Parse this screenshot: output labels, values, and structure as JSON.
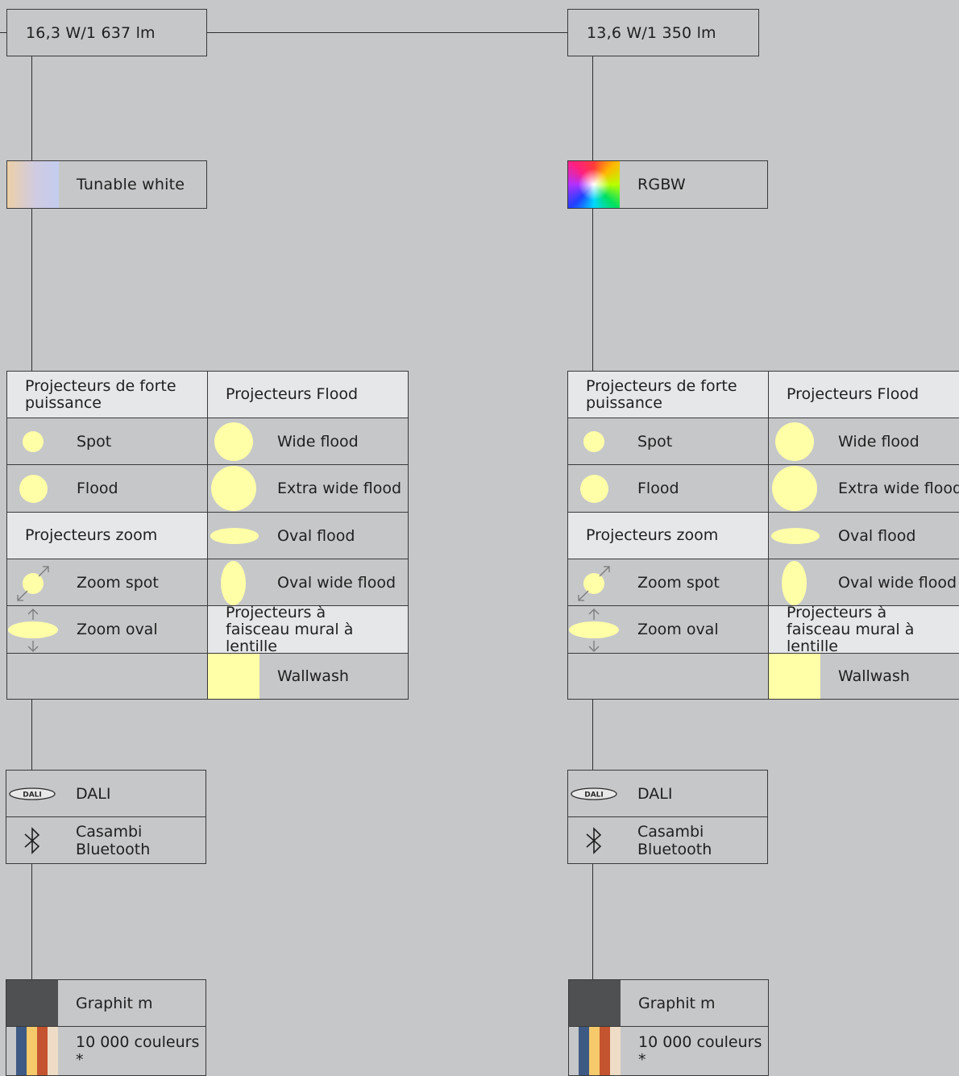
{
  "columns": [
    {
      "power": "16,3 W/1 637 lm",
      "color_mode": "Tunable white",
      "optics": {
        "high_power_header": "Projecteurs de forte puissance",
        "flood_header": "Projecteurs Flood",
        "zoom_header": "Projecteurs zoom",
        "wallwash_header": "Projecteurs à faisceau mural à lentille",
        "spot": "Spot",
        "flood": "Flood",
        "zoom_spot": "Zoom spot",
        "zoom_oval": "Zoom oval",
        "wide_flood": "Wide flood",
        "extra_wide_flood": "Extra wide flood",
        "oval_flood": "Oval flood",
        "oval_wide_flood": "Oval wide flood",
        "wallwash": "Wallwash"
      },
      "control": {
        "dali": "DALI",
        "dali_logo": "DALI",
        "bluetooth": "Casambi Bluetooth"
      },
      "finish": {
        "graphit": "Graphit m",
        "colors": "10 000 couleurs *"
      }
    },
    {
      "power": "13,6 W/1 350 lm",
      "color_mode": "RGBW",
      "optics": {
        "high_power_header": "Projecteurs de forte puissance",
        "flood_header": "Projecteurs Flood",
        "zoom_header": "Projecteurs zoom",
        "wallwash_header": "Projecteurs à faisceau mural à lentille",
        "spot": "Spot",
        "flood": "Flood",
        "zoom_spot": "Zoom spot",
        "zoom_oval": "Zoom oval",
        "wide_flood": "Wide flood",
        "extra_wide_flood": "Extra wide flood",
        "oval_flood": "Oval flood",
        "oval_wide_flood": "Oval wide flood",
        "wallwash": "Wallwash"
      },
      "control": {
        "dali": "DALI",
        "dali_logo": "DALI",
        "bluetooth": "Casambi Bluetooth"
      },
      "finish": {
        "graphit": "Graphit m",
        "colors": "10 000 couleurs *"
      }
    }
  ],
  "colors": {
    "background": "#c6c7c9",
    "beam_yellow": "#ffffa8",
    "graphit": "#4f5052",
    "header_bg": "#e6e7e9",
    "stripe_blue": "#3d5a84",
    "stripe_yellow": "#f6c96b",
    "stripe_red": "#c4532f",
    "stripe_cream": "#efdcc6"
  },
  "icons": [
    "spot-beam-icon",
    "flood-beam-icon",
    "zoom-arrows-icon",
    "oval-beam-icon",
    "wallwash-icon",
    "dali-logo-icon",
    "bluetooth-icon",
    "rgb-gradient-icon",
    "tunable-white-gradient-icon"
  ]
}
